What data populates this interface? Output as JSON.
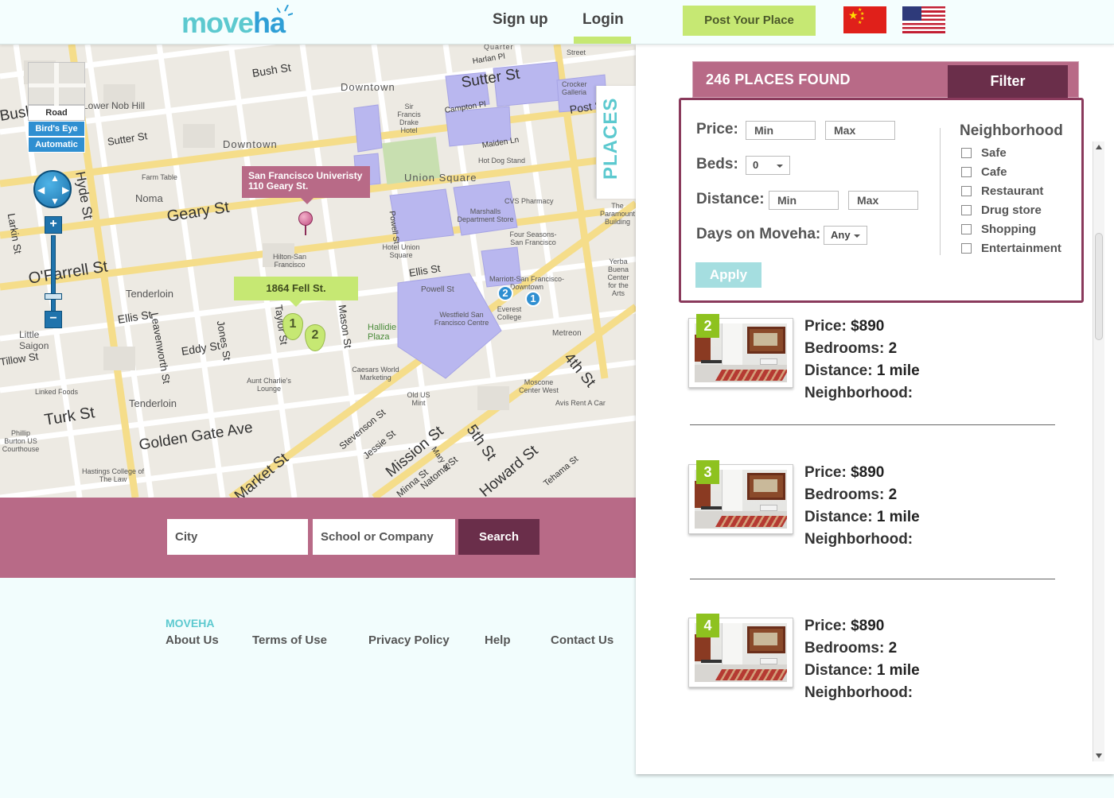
{
  "header": {
    "logo_part1": "move",
    "logo_part2": "ha",
    "signup": "Sign up",
    "login": "Login",
    "post_button": "Post Your Place",
    "flags": [
      "china-flag-icon",
      "us-flag-icon"
    ],
    "accent_color": "#c6e873",
    "brand_color": "#5cc9cf"
  },
  "map": {
    "mode_road": "Road",
    "mode_birds_eye": "Bird's Eye",
    "mode_automatic": "Automatic",
    "zoom_in": "+",
    "zoom_out": "−",
    "places_tab": "PLACES",
    "callout_pink": {
      "line1": "San Francisco Univeristy",
      "line2": "110 Geary St."
    },
    "callout_green": "1864 Fell St.",
    "green_pins": [
      "1",
      "2"
    ],
    "blue_pins": [
      "2",
      "1"
    ],
    "streets": [
      "Bush St",
      "Sutter St",
      "Geary St",
      "O'Farrell St",
      "Ellis St",
      "Eddy St",
      "Turk St",
      "Golden Gate Ave",
      "Market St",
      "Mission St",
      "Howard St",
      "4th St",
      "5th St",
      "Hyde St",
      "Larkin St",
      "Jones St",
      "Leavenworth St",
      "Bush St",
      "Post St",
      "Sutter St",
      "Ellis St",
      "Stevenson St",
      "Jessie St",
      "Minna St",
      "Natoma St",
      "Mary St",
      "Powell St",
      "Campton Pl",
      "Maiden Ln",
      "Harlan Pl",
      "Taylor St",
      "Mason St",
      "Tehama St",
      "Tillow St"
    ],
    "labels": [
      "Downtown",
      "Lower Nob Hill",
      "Downtown",
      "Union Square",
      "Tenderloin",
      "Tenderloin",
      "Little Saigon",
      "Noma",
      "Sir Francis Drake Hotel",
      "Crocker Galleria",
      "Hot Dog Stand",
      "CVS Pharmacy",
      "Marshalls Department Store",
      "Four Seasons-San Francisco",
      "Hilton-San Francisco",
      "Hotel Union Square",
      "Powell St",
      "Westfield San Francisco Centre",
      "Marriott-San Francisco-Downtown",
      "Everest College",
      "Metreon",
      "Yerba Buena Center for the Arts",
      "The Paramount Building",
      "Hallidie Plaza",
      "Caesars World Marketing",
      "Aunt Charlie's Lounge",
      "Old US Mint",
      "Moscone Center West",
      "Avis Rent A Car",
      "Linked Foods",
      "Phillip Burton US Courthouse",
      "Hastings College of The Law",
      "Farm Table",
      "Street",
      "Quarter"
    ]
  },
  "search": {
    "city_placeholder": "City",
    "school_placeholder": "School or Company",
    "button": "Search"
  },
  "footer": {
    "brand": "MOVEHA",
    "links": [
      "About Us",
      "Terms of Use",
      "Privacy Policy",
      "Help",
      "Contact Us"
    ]
  },
  "results": {
    "count_text": "246 PLACES FOUND",
    "filter_tab": "Filter",
    "filter": {
      "price_label": "Price:",
      "min_placeholder": "Min",
      "max_placeholder": "Max",
      "beds_label": "Beds:",
      "beds_value": "0",
      "distance_label": "Distance:",
      "days_label": "Days on Moveha:",
      "days_value": "Any",
      "apply": "Apply",
      "neighborhood_title": "Neighborhood",
      "neighborhoods": [
        "Safe",
        "Cafe",
        "Restaurant",
        "Drug store",
        "Shopping",
        "Entertainment"
      ]
    },
    "listings": [
      {
        "number": "2",
        "price_label": "Price:",
        "price": "$890",
        "bedrooms_label": "Bedrooms:",
        "bedrooms": "2",
        "distance_label": "Distance:",
        "distance": "1 mile",
        "neighborhood_label": "Neighborhood:"
      },
      {
        "number": "3",
        "price_label": "Price:",
        "price": "$890",
        "bedrooms_label": "Bedrooms:",
        "bedrooms": "2",
        "distance_label": "Distance:",
        "distance": "1 mile",
        "neighborhood_label": "Neighborhood:"
      },
      {
        "number": "4",
        "price_label": "Price:",
        "price": "$890",
        "bedrooms_label": "Bedrooms:",
        "bedrooms": "2",
        "distance_label": "Distance:",
        "distance": "1 mile",
        "neighborhood_label": "Neighborhood:"
      }
    ]
  }
}
